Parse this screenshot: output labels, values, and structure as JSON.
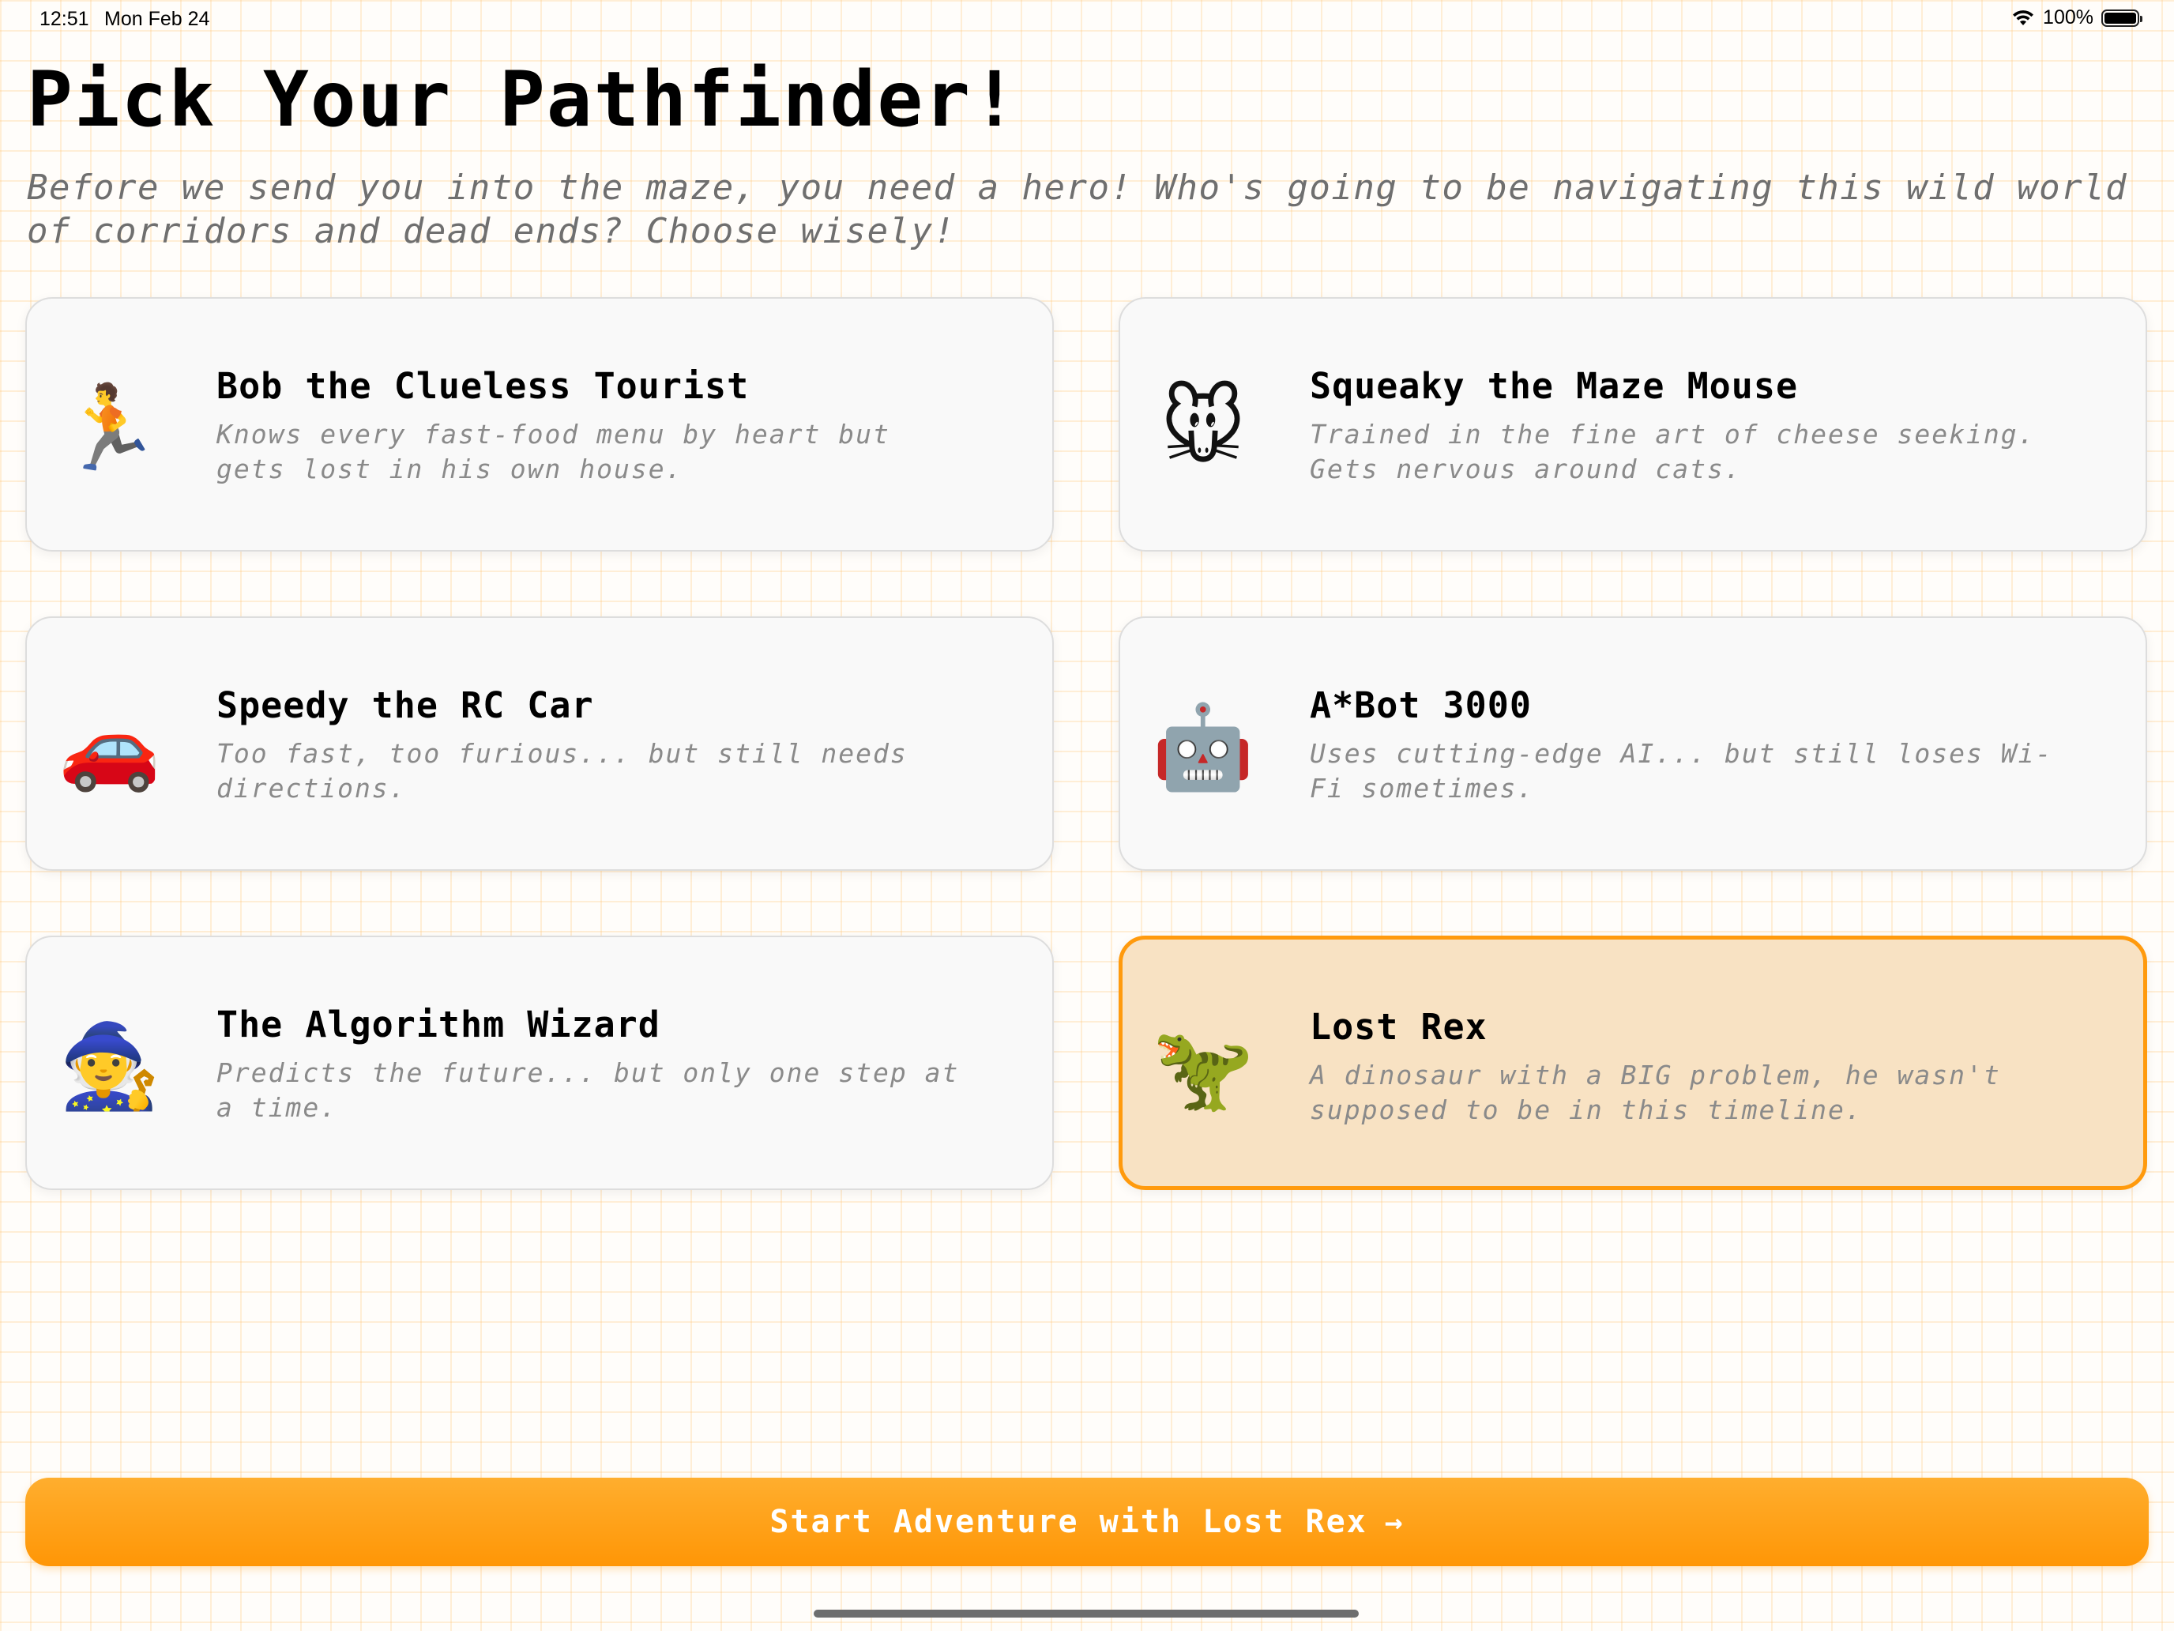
{
  "status_bar": {
    "time": "12:51",
    "date": "Mon Feb 24",
    "battery": "100%",
    "battery_level": 1.0
  },
  "header": {
    "title": "Pick Your Pathfinder!",
    "subtitle": "Before we send you into the maze, you need a hero! Who's going to be navigating this wild world of corridors and dead ends? Choose wisely!"
  },
  "characters": [
    {
      "emoji": "🏃",
      "icon": "runner-icon",
      "name": "Bob the Clueless Tourist",
      "description": "Knows every fast-food menu by heart but gets lost in his own house.",
      "selected": false
    },
    {
      "emoji": "🐭",
      "icon": "mouse-icon",
      "name": "Squeaky the Maze Mouse",
      "description": "Trained in the fine art of cheese seeking. Gets nervous around cats.",
      "selected": false
    },
    {
      "emoji": "🚗",
      "icon": "car-icon",
      "name": "Speedy the RC Car",
      "description": "Too fast, too furious... but still needs directions.",
      "selected": false
    },
    {
      "emoji": "🤖",
      "icon": "robot-icon",
      "name": "A*Bot 3000",
      "description": "Uses cutting-edge AI... but still loses Wi-Fi sometimes.",
      "selected": false
    },
    {
      "emoji": "🧙",
      "icon": "wizard-icon",
      "name": "The Algorithm Wizard",
      "description": "Predicts the future... but only one step at a time.",
      "selected": false
    },
    {
      "emoji": "🦖",
      "icon": "dinosaur-icon",
      "name": "Lost Rex",
      "description": "A dinosaur with a BIG problem, he wasn't supposed to be in this timeline.",
      "selected": true
    }
  ],
  "start_button": {
    "label": "Start Adventure with Lost Rex",
    "arrow": "→"
  },
  "colors": {
    "accent": "#ff9a0d",
    "selected_bg": "#f8e2c3",
    "card_bg": "#f9f9f9",
    "description_text": "#8a8a8a",
    "grid_line": "#ffc478"
  }
}
